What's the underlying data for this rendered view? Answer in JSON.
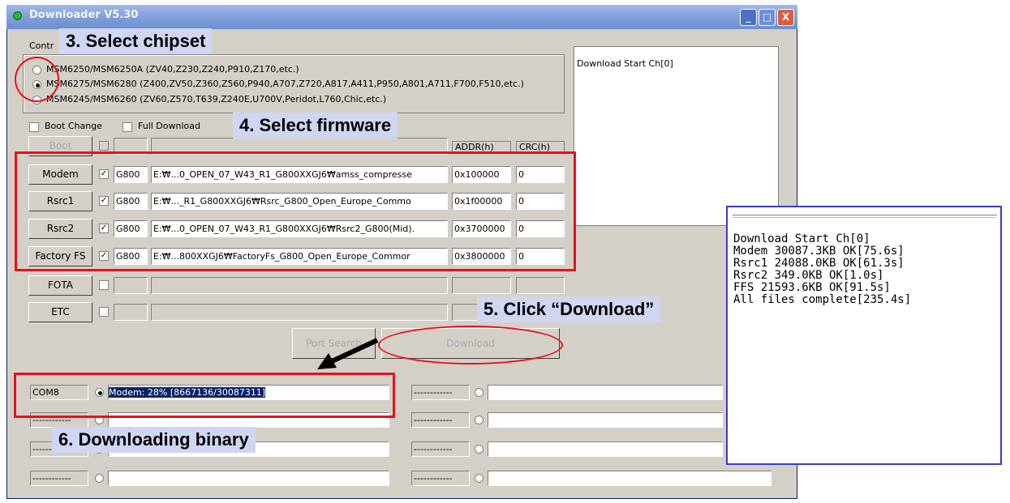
{
  "window": {
    "title": "Downloader V5.30",
    "minimize": "_",
    "maximize": "□",
    "close": "X"
  },
  "control_group": {
    "legend": "Contr"
  },
  "chipsets": [
    {
      "label": "MSM6250/MSM6250A (ZV40,Z230,Z240,P910,Z170,etc.)",
      "selected": false
    },
    {
      "label": "MSM6275/MSM6280 (Z400,ZV50,Z360,Z560,P940,A707,Z720,A817,A411,P950,A801,A711,F700,F510,etc.)",
      "selected": true
    },
    {
      "label": "MSM6245/MSM6260 (ZV60,Z570,T639,Z240E,U700V,Peridot,L760,Chic,etc.)",
      "selected": false
    }
  ],
  "options": {
    "boot_change": "Boot Change",
    "full_download": "Full Download"
  },
  "columns": {
    "addr": "ADDR(h)",
    "crc": "CRC(h)"
  },
  "firmware_rows": [
    {
      "button": "Boot",
      "enabled": false,
      "checked": false,
      "model": "",
      "path": "",
      "addr": "",
      "crc": ""
    },
    {
      "button": "Modem",
      "enabled": true,
      "checked": true,
      "model": "G800",
      "path": "E:₩...0_OPEN_07_W43_R1_G800XXGJ6₩amss_compresse",
      "addr": "0x100000",
      "crc": "0"
    },
    {
      "button": "Rsrc1",
      "enabled": true,
      "checked": true,
      "model": "G800",
      "path": "E:₩..._R1_G800XXGJ6₩Rsrc_G800_Open_Europe_Commo",
      "addr": "0x1f00000",
      "crc": "0"
    },
    {
      "button": "Rsrc2",
      "enabled": true,
      "checked": true,
      "model": "G800",
      "path": "E:₩...0_OPEN_07_W43_R1_G800XXGJ6₩Rsrc2_G800(Mid).",
      "addr": "0x3700000",
      "crc": "0"
    },
    {
      "button": "Factory FS",
      "enabled": true,
      "checked": true,
      "model": "G800",
      "path": "E:₩...800XXGJ6₩FactoryFs_G800_Open_Europe_Commor",
      "addr": "0x3800000",
      "crc": "0"
    },
    {
      "button": "FOTA",
      "enabled": true,
      "checked": false,
      "model": "",
      "path": "",
      "addr": "",
      "crc": ""
    },
    {
      "button": "ETC",
      "enabled": true,
      "checked": false,
      "model": "",
      "path": "",
      "addr": "",
      "crc": ""
    }
  ],
  "actions": {
    "port_search": "Port Search",
    "download": "Download"
  },
  "log": {
    "line1": "Download Start Ch[0]"
  },
  "ports": {
    "left": [
      {
        "com": "COM8",
        "status": "Modem:  28% [8667136/30087311]"
      },
      {
        "com": "------------",
        "status": ""
      },
      {
        "com": "------------",
        "status": ""
      },
      {
        "com": "------------",
        "status": ""
      }
    ],
    "right": [
      {
        "com": "------------",
        "status": ""
      },
      {
        "com": "------------",
        "status": ""
      },
      {
        "com": "------------",
        "status": ""
      },
      {
        "com": "------------",
        "status": ""
      }
    ]
  },
  "popup_log": [
    "Download Start Ch[0]",
    "Modem 30087.3KB OK[75.6s]",
    "Rsrc1 24088.0KB OK[61.3s]",
    "Rsrc2 349.0KB OK[1.0s]",
    "FFS 21593.6KB OK[91.5s]",
    "All files complete[235.4s]"
  ],
  "callouts": {
    "step3": "3. Select chipset",
    "step4": "4. Select firmware",
    "step5": "5. Click “Download”",
    "step6": "6. Downloading binary"
  },
  "colors": {
    "highlight": "#e8101c",
    "callout_bg": "#cfd6f2",
    "popup_border": "#3a3ac0"
  }
}
